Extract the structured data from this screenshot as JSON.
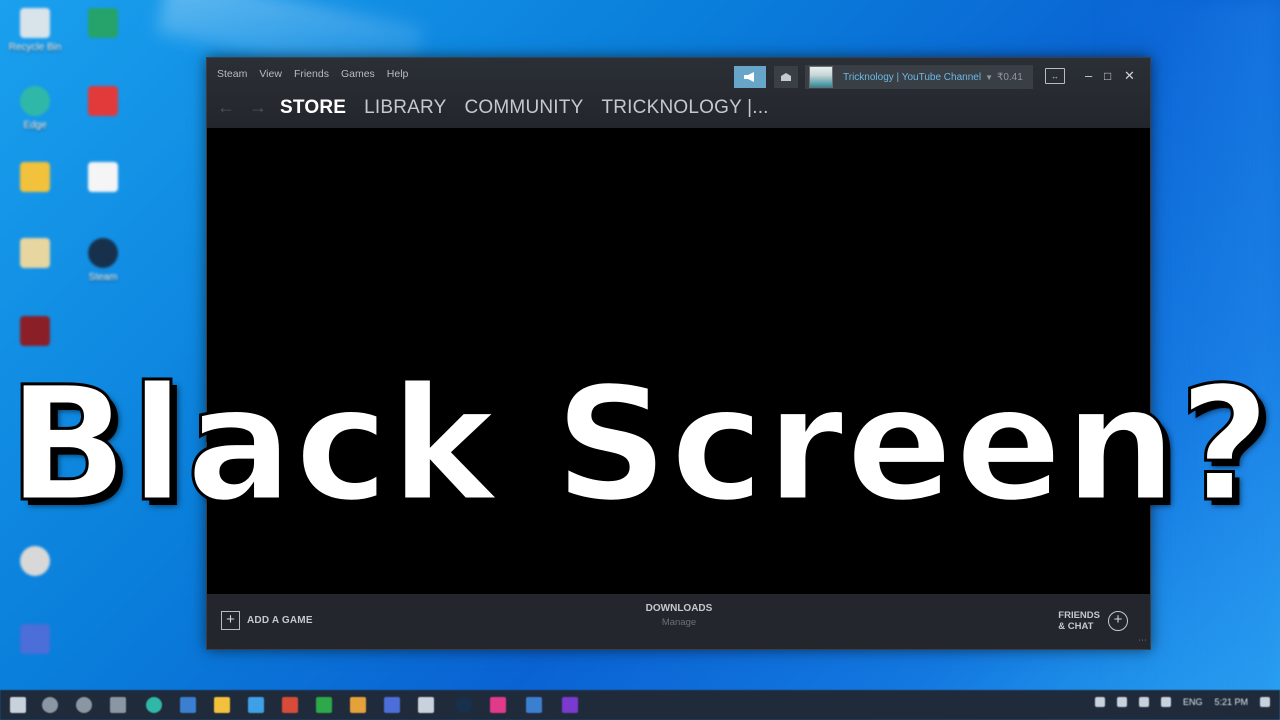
{
  "desktop": {
    "icons": [
      {
        "label": "Recycle Bin",
        "icon": "recycle-bin-icon",
        "color": "#d9e3ea"
      },
      {
        "label": "Edge",
        "icon": "edge-icon",
        "color": "#2fb8a7"
      },
      {
        "label": "",
        "icon": "folder-icon",
        "color": "#f2c23c"
      },
      {
        "label": "",
        "icon": "document-icon",
        "color": "#e8d6a0"
      },
      {
        "label": "",
        "icon": "game-icon",
        "color": "#8a1f28"
      },
      {
        "label": "",
        "icon": "app-icon",
        "color": "#25a36a"
      },
      {
        "label": "",
        "icon": "app-icon",
        "color": "#3a7fd0"
      },
      {
        "label": "",
        "icon": "music-icon",
        "color": "#d8d8d8"
      },
      {
        "label": "",
        "icon": "store-icon",
        "color": "#4b6ed8"
      },
      {
        "label": "",
        "icon": "app-icon",
        "color": "#2da84a"
      },
      {
        "label": "",
        "icon": "video-icon",
        "color": "#e23a3a"
      },
      {
        "label": "",
        "icon": "document-icon",
        "color": "#f5f5f5"
      },
      {
        "label": "Steam",
        "icon": "steam-icon",
        "color": "#17314d"
      }
    ]
  },
  "steam": {
    "menu": [
      "Steam",
      "View",
      "Friends",
      "Games",
      "Help"
    ],
    "nav": [
      "STORE",
      "LIBRARY",
      "COMMUNITY",
      "TRICKNOLOGY |..."
    ],
    "account_name": "Tricknology | YouTube Channel",
    "balance": "₹0.41",
    "bottom": {
      "add_game": "ADD A GAME",
      "downloads": "DOWNLOADS",
      "downloads_sub": "Manage",
      "friends_line1": "FRIENDS",
      "friends_line2": "& CHAT"
    }
  },
  "overlay": {
    "headline": "Black Screen?"
  },
  "taskbar": {
    "language": "ENG",
    "time": "5:21 PM"
  },
  "colors": {
    "desktop_blue": "#0a7fdb",
    "steam_bg": "#23262c",
    "steam_accent": "#67a5c9",
    "account_link": "#6ab9e6"
  }
}
